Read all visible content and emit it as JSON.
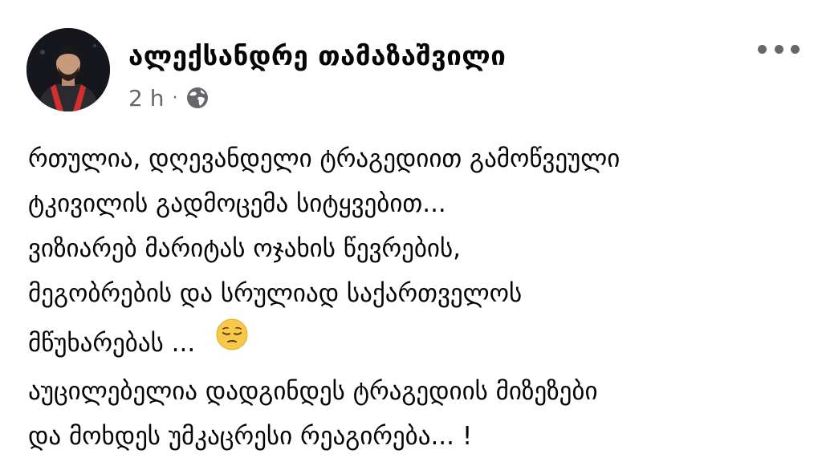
{
  "post": {
    "author": "ალექსანდრე თამაზაშვილი",
    "time": "2 h",
    "separator": "·",
    "audience_icon": "globe-icon",
    "more_icon": "more-options-icon",
    "avatar_icon": "avatar",
    "emoji_icon": "pensive-face-emoji",
    "lines": [
      "რთულია,  დღევანდელი ტრაგედიით გამოწვეული",
      "ტკივილის გადმოცემა სიტყვებით...",
      " ვიზიარებ  მარიტას ოჯახის წევრების,",
      "მეგობრების და  სრულიად საქართველოს",
      "მწუხარებას ...",
      " აუცილებელია დადგინდეს ტრაგედიის მიზეზები",
      "და მოხდეს უმკაცრესი რეაგირება... !"
    ]
  },
  "colors": {
    "text": "#050505",
    "secondary": "#65676b",
    "emoji": "#f7c948",
    "scarf": "#d32f2f"
  }
}
